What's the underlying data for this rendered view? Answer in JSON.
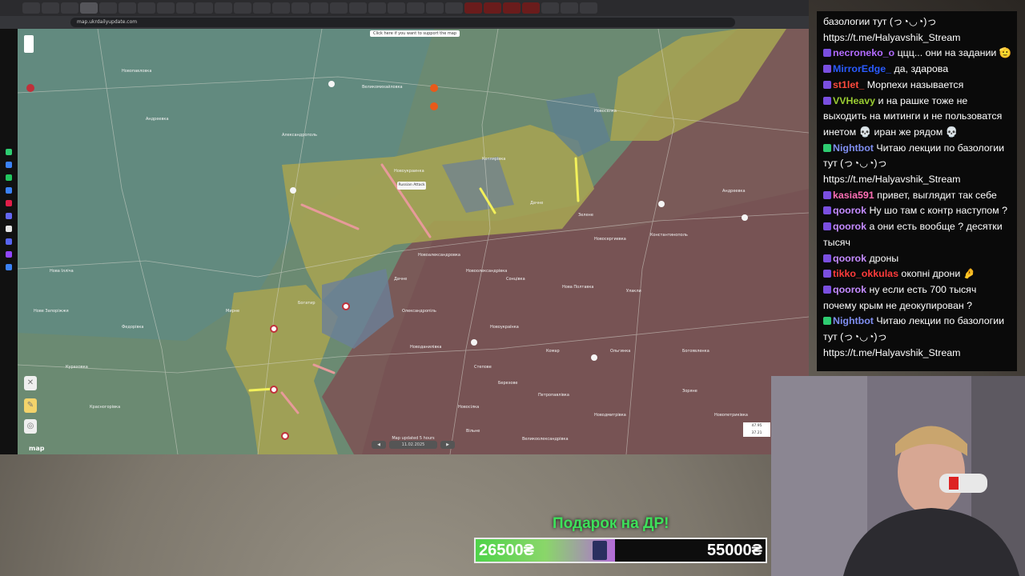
{
  "browser": {
    "url": "map.ukrdailyupdate.com",
    "tab_count": 30
  },
  "map": {
    "banner": "Click here if you want to support the map",
    "popup": "Russian Attack",
    "updated": "Map updated 5 hours ago",
    "date": "11.02.2025",
    "logo": "map",
    "labels": [
      "Новопавловка",
      "Великомихайловка",
      "Новоселка",
      "Андреевка",
      "Александрополь",
      "Новоукраинка",
      "Котлярівка",
      "Дачне",
      "Зелене",
      "Новосергиевка",
      "Константинополь",
      "Андреевка",
      "Новоалександровка",
      "Новоолександрівка",
      "Сонцівка",
      "Нова Полтавка",
      "Улакли",
      "Дачне",
      "Богатир",
      "Мирне",
      "Нова Ілліча",
      "Нове Запоріжжя",
      "Федорівка",
      "Кураховка",
      "Красногорівка",
      "Олександропіль",
      "Новоукраїнка",
      "Комар",
      "Ольгинка",
      "Богоявленка",
      "Новоданилівка",
      "Степове",
      "Березове",
      "Петропавлівка",
      "Новодмитрівка",
      "Новосілка",
      "Зоряне",
      "Новопетриківка",
      "Великоолександрівка",
      "Вільне"
    ]
  },
  "chat": {
    "messages": [
      {
        "user": "",
        "color": "#ffffff",
        "text": "базологии тут (っ◔◡◔)っ https://t.me/Halyavshik_Stream",
        "badge": ""
      },
      {
        "user": "necroneko_o",
        "color": "#b26bff",
        "text": "ццц... они на задании 🫡",
        "badge": "#7a4fe0"
      },
      {
        "user": "MirrorEdge_",
        "color": "#2a5bff",
        "text": "да, здарова",
        "badge": "#7a4fe0"
      },
      {
        "user": "st1let_",
        "color": "#ff4a3d",
        "text": "Морпехи называется",
        "badge": "#7a4fe0"
      },
      {
        "user": "VVHeavy",
        "color": "#9acd32",
        "text": "и на рашке тоже не выходить на митинги и не пользоватся инетом 💀 иран же рядом 💀",
        "badge": "#7a4fe0"
      },
      {
        "user": "Nightbot",
        "color": "#7f8ef0",
        "text": "Читаю лекции по базологии тут (っ◔◡◔)っ https://t.me/Halyavshik_Stream",
        "badge": "#2ecc71"
      },
      {
        "user": "kasia591",
        "color": "#ff6fb5",
        "text": "привет, выглядит так себе",
        "badge": "#7a4fe0"
      },
      {
        "user": "qoorok",
        "color": "#c48bff",
        "text": "Ну шо там с контр наступом ?",
        "badge": "#7a4fe0"
      },
      {
        "user": "qoorok",
        "color": "#c48bff",
        "text": "а они есть вообще ? десятки тысяч",
        "badge": "#7a4fe0"
      },
      {
        "user": "qoorok",
        "color": "#c48bff",
        "text": "дроны",
        "badge": "#7a4fe0"
      },
      {
        "user": "tikko_okkulas",
        "color": "#ff3b3b",
        "text": "окопні дрони 🤌",
        "badge": "#7a4fe0"
      },
      {
        "user": "qoorok",
        "color": "#c48bff",
        "text": "ну если есть 700 тысяч почему крым не деокупирован ?",
        "badge": "#7a4fe0"
      },
      {
        "user": "Nightbot",
        "color": "#7f8ef0",
        "text": "Читаю лекции по базологии тут (っ◔◡◔)っ https://t.me/Halyavshik_Stream",
        "badge": "#2ecc71"
      }
    ]
  },
  "goal": {
    "title": "Подарок на ДР!",
    "current": "26500₴",
    "target": "55000₴",
    "progress": 0.4818
  }
}
